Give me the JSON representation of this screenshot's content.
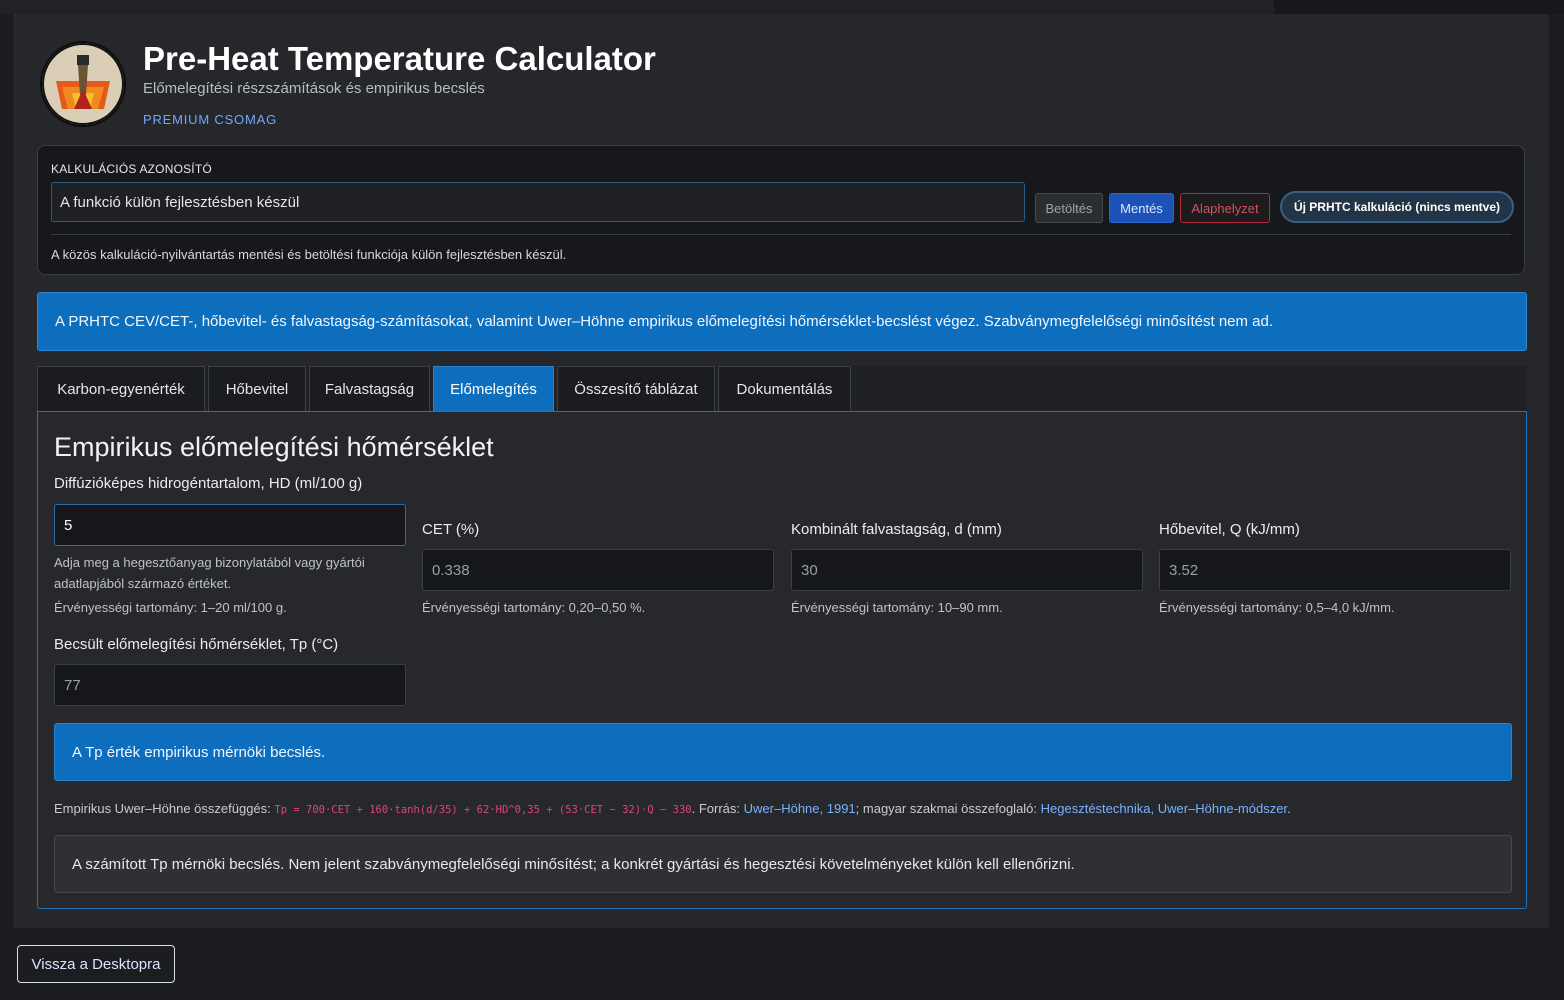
{
  "header": {
    "title": "Pre-Heat Temperature Calculator",
    "subtitle": "Előmelegítési részszámítások és empirikus becslés",
    "package": "PREMIUM CSOMAG"
  },
  "calc_id": {
    "label": "KALKULÁCIÓS AZONOSÍTÓ",
    "value": "A funkció külön fejlesztésben készül",
    "load_label": "Betöltés",
    "save_label": "Mentés",
    "reset_label": "Alaphelyzet",
    "new_calc_label": "Új PRHTC kalkuláció (nincs mentve)",
    "note": "A közös kalkuláció-nyilvántartás mentési és betöltési funkciója külön fejlesztésben készül."
  },
  "info_banner": "A PRHTC CEV/CET-, hőbevitel- és falvastagság-számításokat, valamint Uwer–Höhne empirikus előmelegítési hőmérséklet-becslést végez. Szabványmegfelelőségi minősítést nem ad.",
  "tabs": [
    {
      "label": "Karbon-egyenérték",
      "active": false
    },
    {
      "label": "Hőbevitel",
      "active": false
    },
    {
      "label": "Falvastagság",
      "active": false
    },
    {
      "label": "Előmelegítés",
      "active": true
    },
    {
      "label": "Összesítő táblázat",
      "active": false
    },
    {
      "label": "Dokumentálás",
      "active": false
    }
  ],
  "preheat": {
    "title": "Empirikus előmelegítési hőmérséklet",
    "hd": {
      "label": "Diffúzióképes hidrogéntartalom, HD (ml/100 g)",
      "value": "5",
      "hint": "Adja meg a hegesztőanyag bizonylatából vagy gyártói adatlapjából származó értéket.",
      "range": "Érvényességi tartomány: 1–20 ml/100 g."
    },
    "cet": {
      "label": "CET (%)",
      "value": "0.338",
      "range": "Érvényességi tartomány: 0,20–0,50 %."
    },
    "thickness": {
      "label": "Kombinált falvastagság, d (mm)",
      "value": "30",
      "range": "Érvényességi tartomány: 10–90 mm."
    },
    "heat_input": {
      "label": "Hőbevitel, Q (kJ/mm)",
      "value": "3.52",
      "range": "Érvényességi tartomány: 0,5–4,0 kJ/mm."
    },
    "tp": {
      "label": "Becsült előmelegítési hőmérséklet, Tp (°C)",
      "value": "77"
    },
    "tp_banner": "A Tp érték empirikus mérnöki becslés.",
    "formula": {
      "prefix": "Empirikus Uwer–Höhne összefüggés: ",
      "code": "Tp = 700·CET + 160·tanh(d/35) + 62·HD^0,35 + (53·CET − 32)·Q − 330",
      "source_prefix": ". Forrás: ",
      "source_link": "Uwer–Höhne, 1991",
      "summary_prefix": "; magyar szakmai összefoglaló: ",
      "summary_link": "Hegesztéstechnika, Uwer–Höhne-módszer",
      "suffix": "."
    },
    "disclaimer": "A számított Tp mérnöki becslés. Nem jelent szabványmegfelelőségi minősítést; a konkrét gyártási és hegesztési követelményeket külön kell ellenőrizni."
  },
  "footer": {
    "back_label": "Vissza a Desktopra"
  },
  "colors": {
    "accent": "#0d6ebd",
    "link": "#7ab2ff",
    "danger": "#b02a37",
    "code": "#e0427c"
  }
}
